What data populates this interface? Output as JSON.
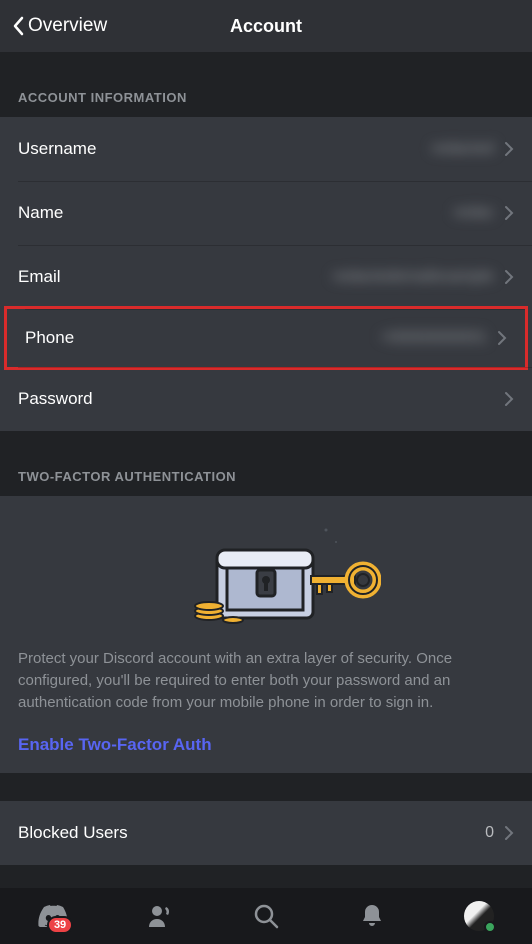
{
  "header": {
    "back_label": "Overview",
    "title": "Account"
  },
  "account_info": {
    "header": "ACCOUNT INFORMATION",
    "rows": {
      "username": {
        "label": "Username",
        "value": "redacted"
      },
      "name": {
        "label": "Name",
        "value": "redac"
      },
      "email": {
        "label": "Email",
        "value": "redactedemailexample"
      },
      "phone": {
        "label": "Phone",
        "value": "+00000000001"
      },
      "password": {
        "label": "Password"
      }
    }
  },
  "twofa": {
    "header": "TWO-FACTOR AUTHENTICATION",
    "description": "Protect your Discord account with an extra layer of security. Once configured, you'll be required to enter both your password and an authentication code from your mobile phone in order to sign in.",
    "link": "Enable Two-Factor Auth"
  },
  "blocked": {
    "label": "Blocked Users",
    "count": "0"
  },
  "nav": {
    "badge_count": "39"
  }
}
